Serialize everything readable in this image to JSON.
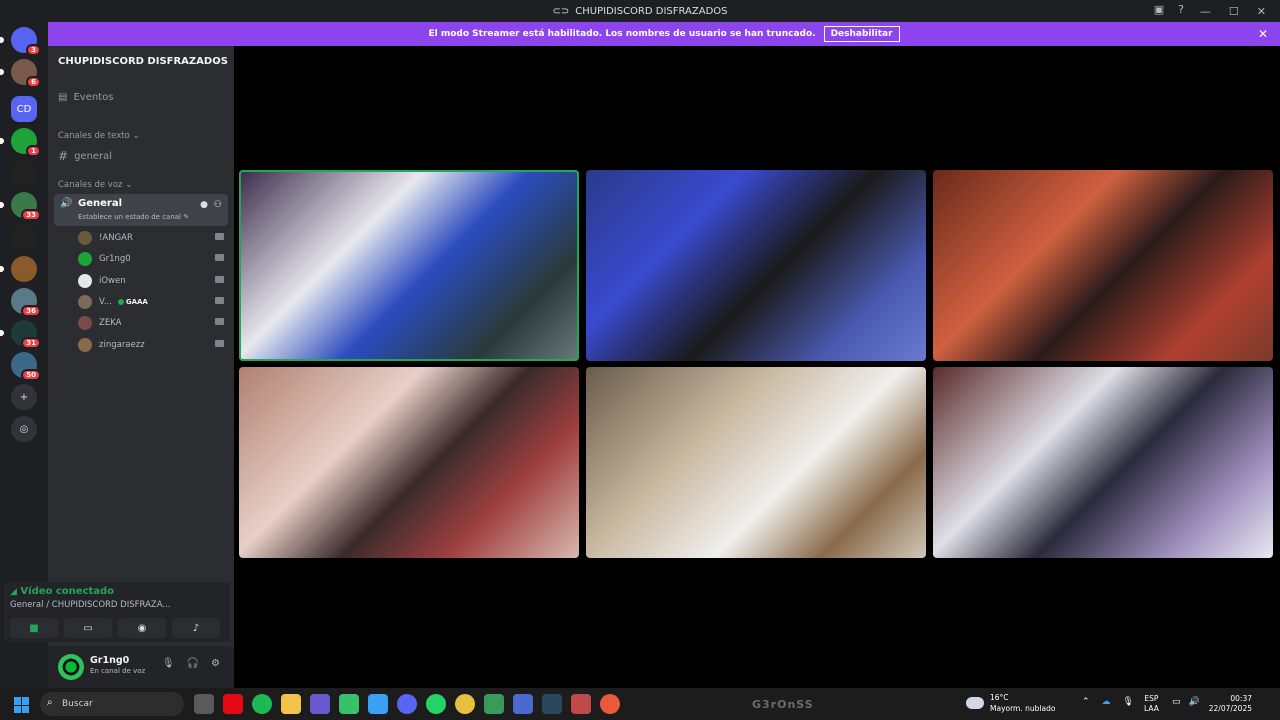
{
  "window": {
    "title": "CHUPIDISCORD DISFRAZADOS"
  },
  "banner": {
    "message": "El modo Streamer está habilitado. Los nombres de usuario se han truncado.",
    "button_label": "Deshabilitar"
  },
  "servers": [
    {
      "label": "",
      "badge": "3",
      "color": "#5865f2"
    },
    {
      "label": "",
      "badge": "6",
      "color": "#7a5a4a"
    },
    {
      "label": "CD",
      "badge": "",
      "color": "#5865f2"
    },
    {
      "label": "",
      "badge": "1",
      "color": "#1ea33a"
    },
    {
      "label": "",
      "badge": "",
      "color": "#222222"
    },
    {
      "label": "",
      "badge": "33",
      "color": "#3a7a4a"
    },
    {
      "label": "",
      "badge": "",
      "color": "#222222"
    },
    {
      "label": "",
      "badge": "",
      "color": "#8a5a2a"
    },
    {
      "label": "",
      "badge": "36",
      "color": "#5a7a8a"
    },
    {
      "label": "",
      "badge": "31",
      "color": "#1f3a3a"
    },
    {
      "label": "",
      "badge": "50",
      "color": "#3a6a8a"
    }
  ],
  "sidebar": {
    "guild_name": "CHUPIDISCORD DISFRAZADOS",
    "events_label": "Eventos",
    "text_category": "Canales de texto",
    "text_channel": "general",
    "voice_category": "Canales de voz",
    "voice_channel": {
      "name": "General",
      "status": "Establece un estado de canal"
    },
    "members": [
      {
        "name": "!ANGAR",
        "color": "#6b5a3a",
        "tag": ""
      },
      {
        "name": "Gr1ng0",
        "color": "#1ea33a",
        "tag": ""
      },
      {
        "name": "iOwen",
        "color": "#e6e6e6",
        "tag": ""
      },
      {
        "name": "V...",
        "color": "#7a6a5a",
        "tag": "GAAA"
      },
      {
        "name": "ZEKA",
        "color": "#7a4a4a",
        "tag": ""
      },
      {
        "name": "zingaraezz",
        "color": "#8a6a4a",
        "tag": ""
      }
    ]
  },
  "voice_panel": {
    "title": "Vídeo conectado",
    "subtitle": "General / CHUPIDISCORD DISFRAZA..."
  },
  "user_panel": {
    "name": "Gr1ng0",
    "status": "En canal de voz"
  },
  "video_tiles": [
    {
      "speaking": true,
      "bg": "linear-gradient(135deg,#3a2a4a 0%,#e8e8ee 35%,#2b4cc0 55%,#2a3a3a 80%,#6a7a7a 100%)"
    },
    {
      "speaking": false,
      "bg": "linear-gradient(135deg,#2a3a8a 0%,#3a4acf 30%,#1a1a1a 55%,#4a5ab0 80%,#6a7ad0 100%)"
    },
    {
      "speaking": false,
      "bg": "linear-gradient(135deg,#6a2a1a 0%,#d06040 35%,#2a1a1a 55%,#b04030 80%,#7a3a2a 100%)"
    },
    {
      "speaking": false,
      "bg": "linear-gradient(135deg,#b08070 0%,#e8d0c8 35%,#3a2a2a 55%,#a04040 75%,#d8b8b0 100%)"
    },
    {
      "speaking": false,
      "bg": "linear-gradient(135deg,#6a5a4a 0%,#c8b8a0 35%,#f0f0ee 60%,#8a6a4a 80%,#d0c8b8 100%)"
    },
    {
      "speaking": false,
      "bg": "linear-gradient(135deg,#5a2a2a 0%,#e0e0e8 35%,#2a2a3a 55%,#a090c0 80%,#e8e8f0 100%)"
    }
  ],
  "taskbar": {
    "search_placeholder": "Buscar",
    "apps": [
      {
        "name": "task-view",
        "color": "#5a5a5a"
      },
      {
        "name": "netflix",
        "color": "#e50914"
      },
      {
        "name": "spotify",
        "color": "#1db954"
      },
      {
        "name": "file-explorer",
        "color": "#f3c24a"
      },
      {
        "name": "app-purple",
        "color": "#6a5acd"
      },
      {
        "name": "app-green",
        "color": "#3ac06a"
      },
      {
        "name": "app-cube",
        "color": "#3aa0f3"
      },
      {
        "name": "discord",
        "color": "#5865f2"
      },
      {
        "name": "whatsapp",
        "color": "#25d366"
      },
      {
        "name": "chrome",
        "color": "#e8c040"
      },
      {
        "name": "app-square",
        "color": "#3a9a5a"
      },
      {
        "name": "app-diamond",
        "color": "#4a6ad0"
      },
      {
        "name": "app-steam",
        "color": "#2a475e"
      },
      {
        "name": "app-tool",
        "color": "#c04a4a"
      },
      {
        "name": "chrome-2",
        "color": "#e85a3a"
      }
    ],
    "watermark": "G3rOnSS",
    "weather_temp": "16°C",
    "weather_desc": "Mayorm. nublado",
    "lang_top": "ESP",
    "lang_bottom": "LAA",
    "time": "00:37",
    "date": "22/07/2025"
  }
}
